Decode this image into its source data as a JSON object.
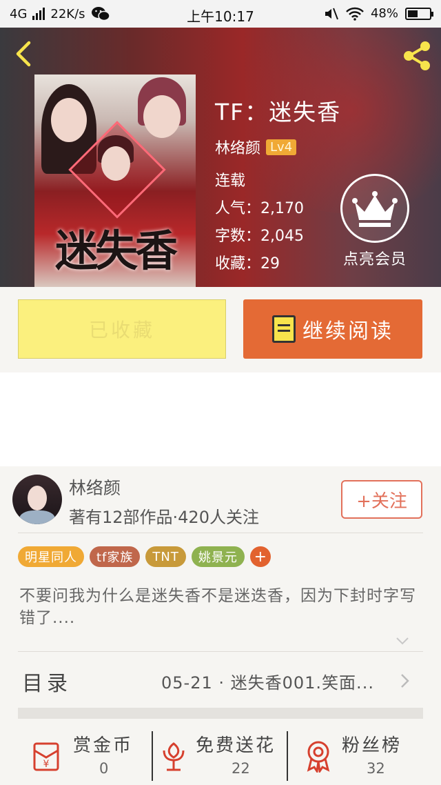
{
  "status_bar": {
    "network": "4G",
    "speed": "22K/s",
    "time": "上午10:17",
    "battery": "48%",
    "battery_level": 0.48
  },
  "book": {
    "title": "TF：迷失香",
    "author": "林络颜",
    "level": "Lv4",
    "status": "连载",
    "popularity_label": "人气：",
    "popularity": "2,170",
    "words_label": "字数：",
    "words": "2,045",
    "favorites_label": "收藏：",
    "favorites": "29",
    "cover_title": "迷失香",
    "vip_label": "点亮会员"
  },
  "actions": {
    "collected_label": "已收藏",
    "continue_label": "继续阅读"
  },
  "author_section": {
    "name": "林络颜",
    "stats": "著有12部作品·420人关注",
    "follow_label": "+关注",
    "tags": [
      "明星同人",
      "tf家族",
      "TNT",
      "姚景元"
    ],
    "tag_colors": [
      "#f0a935",
      "#c0674b",
      "#c89a3a",
      "#8fb250"
    ],
    "add_tag_label": "+",
    "description": "不要问我为什么是迷失香不是迷迭香，因为下封时字写错了...."
  },
  "toc": {
    "label": "目录",
    "latest": "05-21 · 迷失香001.笑面..."
  },
  "bottom_bar": {
    "reward_label": "赏金币",
    "reward_value": "0",
    "flowers_label": "免费送花",
    "flowers_value": "22",
    "fans_label": "粉丝榜",
    "fans_value": "32"
  },
  "colors": {
    "accent": "#e46a35",
    "collected_bg": "#fbf07e",
    "icon_red": "#d6402e"
  }
}
